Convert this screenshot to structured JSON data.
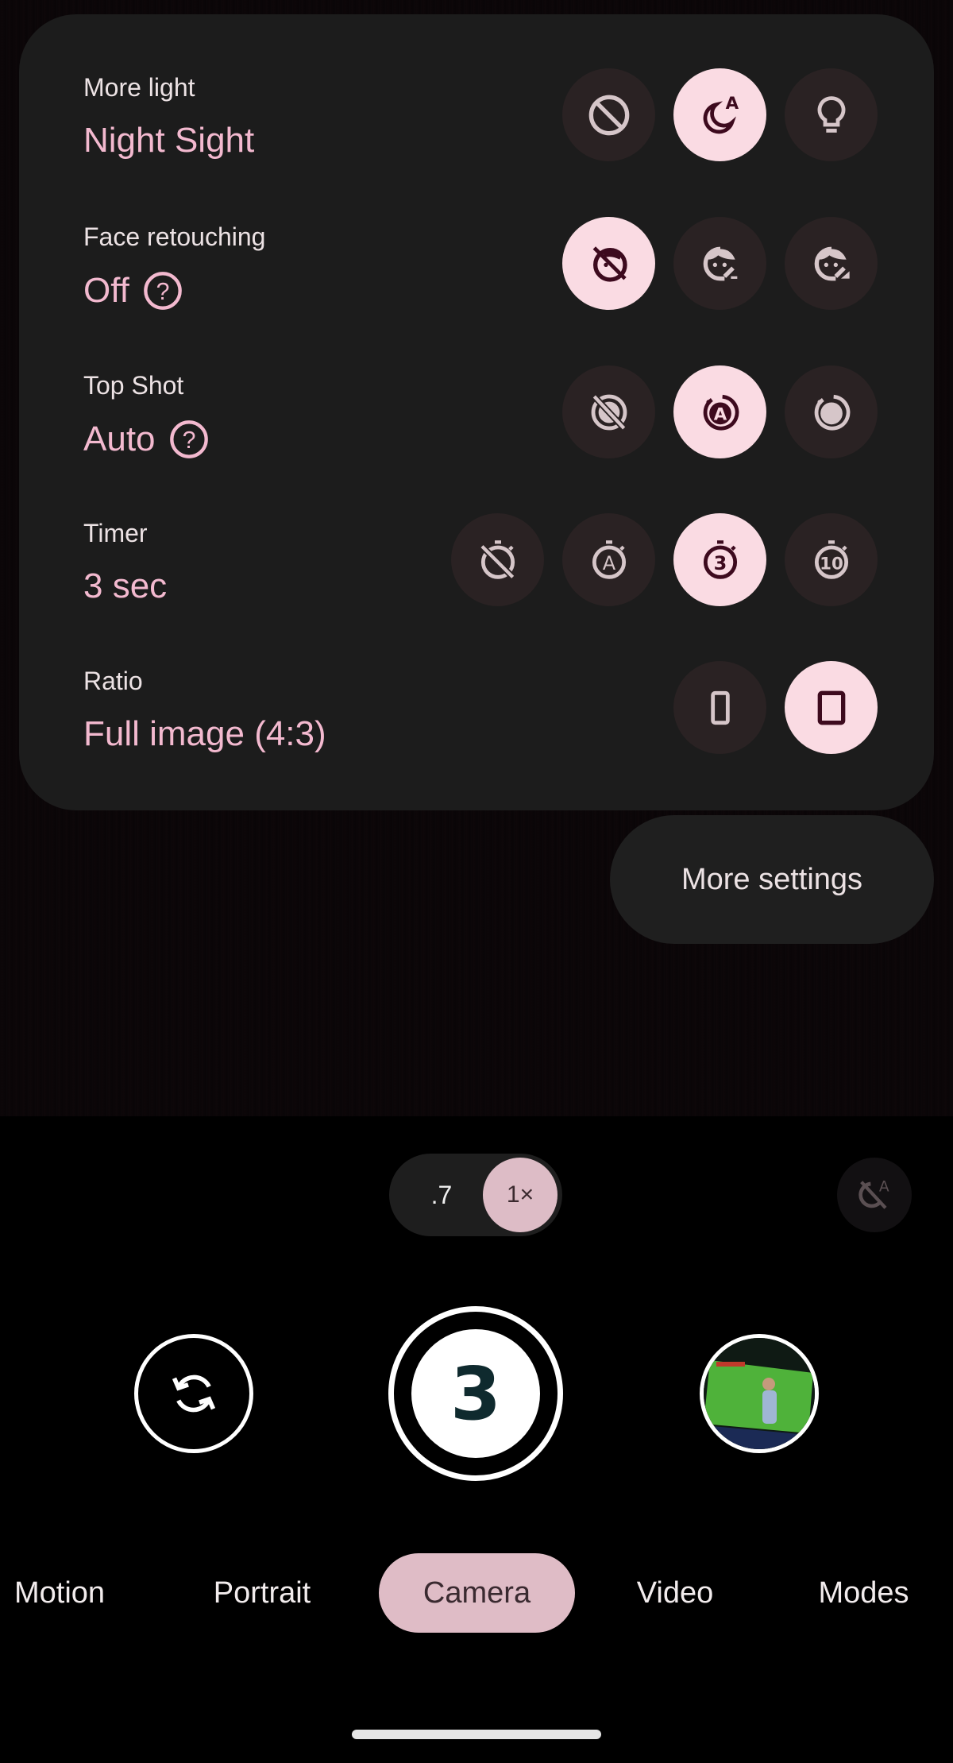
{
  "quick_settings": {
    "rows": [
      {
        "label": "More light",
        "value": "Night Sight",
        "has_help": false,
        "options": [
          {
            "icon": "block-icon",
            "name": "off",
            "selected": false
          },
          {
            "icon": "night-sight-auto-icon",
            "name": "night-sight-auto",
            "selected": true
          },
          {
            "icon": "lightbulb-icon",
            "name": "torch",
            "selected": false
          }
        ]
      },
      {
        "label": "Face retouching",
        "value": "Off",
        "has_help": true,
        "options": [
          {
            "icon": "face-retouching-off-icon",
            "name": "off",
            "selected": true
          },
          {
            "icon": "face-retouching-subtle-icon",
            "name": "subtle",
            "selected": false
          },
          {
            "icon": "face-retouching-smooth-icon",
            "name": "smooth",
            "selected": false
          }
        ]
      },
      {
        "label": "Top Shot",
        "value": "Auto",
        "has_help": true,
        "options": [
          {
            "icon": "motion-photo-off-icon",
            "name": "off",
            "selected": false
          },
          {
            "icon": "motion-photo-auto-icon",
            "name": "auto",
            "selected": true
          },
          {
            "icon": "motion-photo-on-icon",
            "name": "on",
            "selected": false
          }
        ]
      },
      {
        "label": "Timer",
        "value": "3 sec",
        "has_help": false,
        "options": [
          {
            "icon": "timer-off-icon",
            "name": "off",
            "selected": false
          },
          {
            "icon": "timer-auto-icon",
            "name": "auto",
            "selected": false,
            "glyph": "A"
          },
          {
            "icon": "timer-3-icon",
            "name": "3-sec",
            "selected": true,
            "glyph": "3"
          },
          {
            "icon": "timer-10-icon",
            "name": "10-sec",
            "selected": false,
            "glyph": "10"
          }
        ]
      },
      {
        "label": "Ratio",
        "value": "Full image (4:3)",
        "has_help": false,
        "options": [
          {
            "icon": "ratio-wide-icon",
            "name": "wide-crop",
            "selected": false
          },
          {
            "icon": "ratio-full-icon",
            "name": "full-image",
            "selected": true
          }
        ]
      }
    ],
    "help_glyph": "?"
  },
  "more_settings_label": "More settings",
  "zoom": {
    "options": [
      ".7",
      "1×"
    ],
    "selected": "1×"
  },
  "flash": {
    "icon": "flash-auto-off-icon",
    "glyph": "A"
  },
  "shutter": {
    "countdown": "3"
  },
  "modes": {
    "items": [
      "Motion",
      "Portrait",
      "Camera",
      "Video",
      "Modes"
    ],
    "active": "Camera"
  },
  "colors": {
    "accent_text": "#f3b9cf",
    "selected_bg": "#fadbe3",
    "selected_icon": "#3d0a1e",
    "unselected_bg": "#2a2223",
    "unselected_icon": "#d6c6c9",
    "active_mode_bg": "#dfbcc6"
  }
}
